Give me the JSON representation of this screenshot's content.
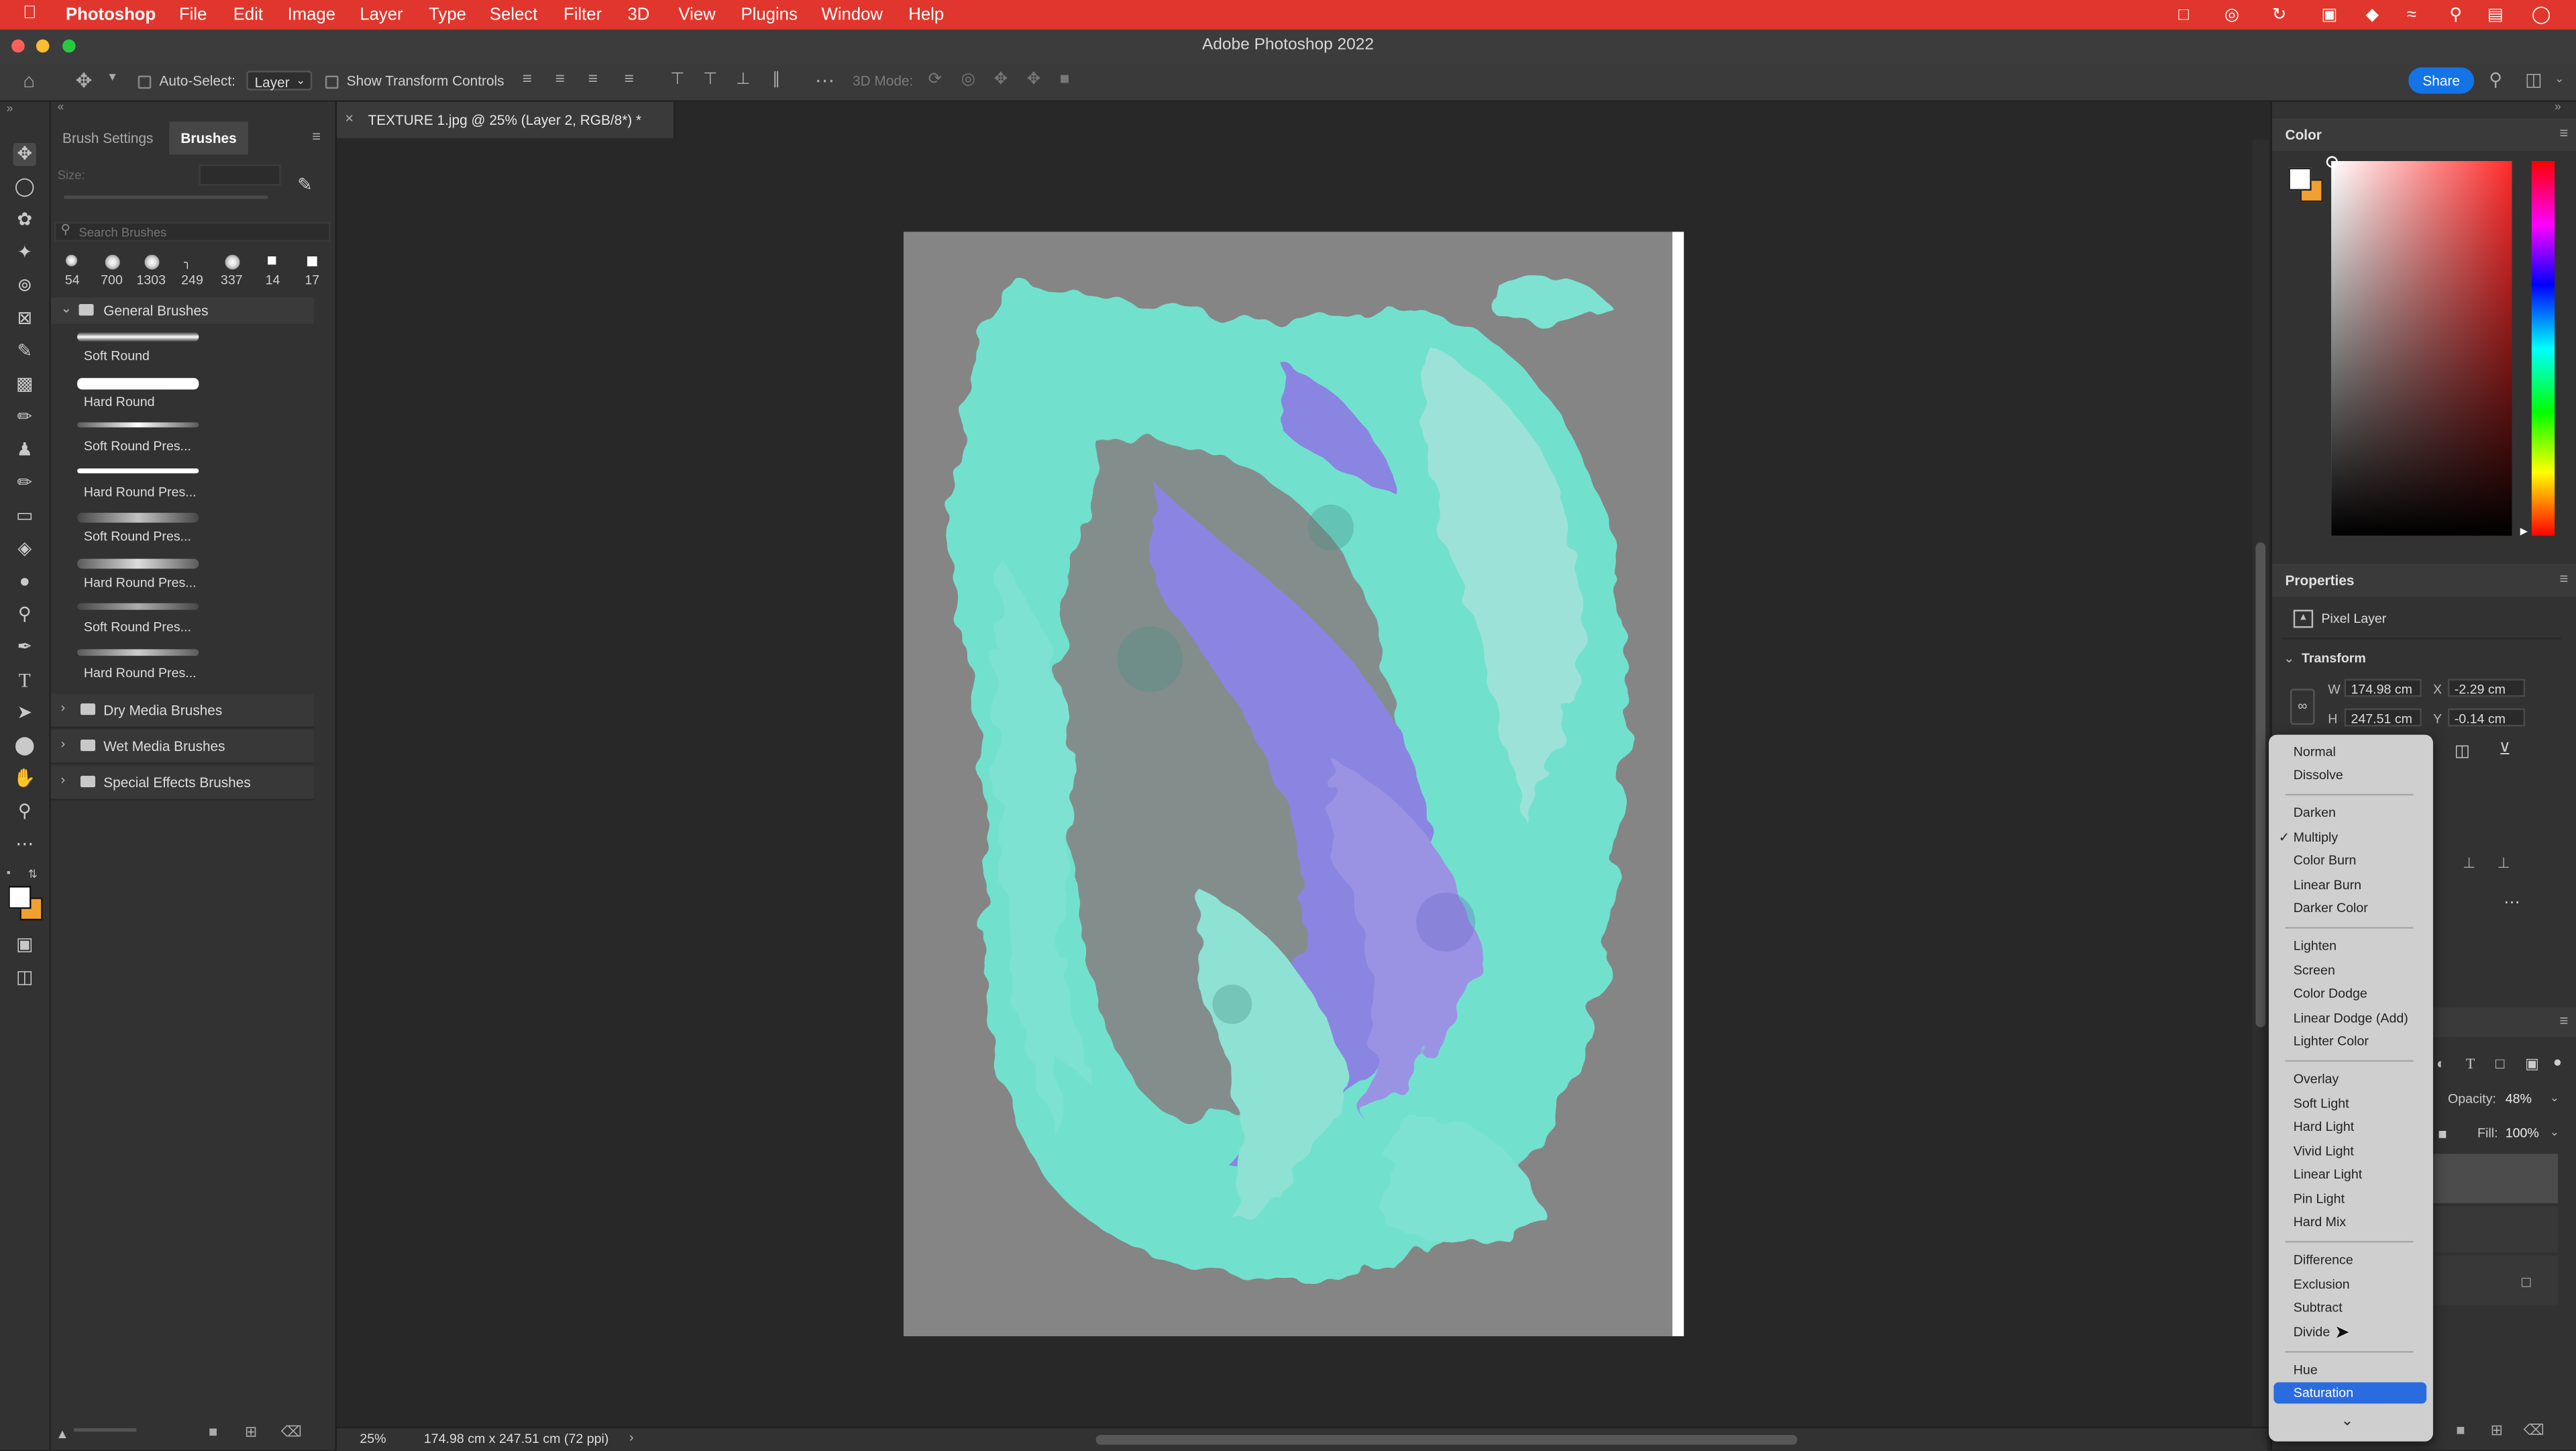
{
  "menubar": {
    "app": "Photoshop",
    "items": [
      "File",
      "Edit",
      "Image",
      "Layer",
      "Type",
      "Select",
      "Filter",
      "3D",
      "View",
      "Plugins",
      "Window",
      "Help"
    ]
  },
  "window": {
    "title": "Adobe Photoshop 2022"
  },
  "options": {
    "auto_select_label": "Auto-Select:",
    "auto_select_value": "Layer",
    "show_transform_label": "Show Transform Controls",
    "mode_3d_label": "3D Mode:",
    "share_label": "Share"
  },
  "left_panel": {
    "tabs": [
      "Brush Settings",
      "Brushes"
    ],
    "size_label": "Size:",
    "search_placeholder": "Search Brushes",
    "recent_sizes": [
      "54",
      "700",
      "1303",
      "249",
      "337",
      "14",
      "17"
    ],
    "group_label": "General Brushes",
    "brushes": [
      "Soft Round",
      "Hard Round",
      "Soft Round Pres...",
      "Hard Round Pres...",
      "Soft Round Pres...",
      "Hard Round Pres...",
      "Soft Round Pres...",
      "Hard Round Pres..."
    ],
    "folders": [
      "Dry Media Brushes",
      "Wet Media Brushes",
      "Special Effects Brushes"
    ]
  },
  "document": {
    "tab_title": "TEXTURE 1.jpg @ 25% (Layer 2, RGB/8*) *",
    "zoom": "25%",
    "dimensions": "174.98 cm x 247.51 cm (72 ppi)"
  },
  "color_panel": {
    "title": "Color"
  },
  "properties": {
    "title": "Properties",
    "layer_type": "Pixel Layer",
    "transform_label": "Transform",
    "w_label": "W",
    "w_value": "174.98 cm",
    "x_label": "X",
    "x_value": "-2.29 cm",
    "h_label": "H",
    "h_value": "247.51 cm",
    "y_label": "Y",
    "y_value": "-0.14 cm"
  },
  "layers": {
    "opacity_label": "Opacity:",
    "opacity_value": "48%",
    "fill_label": "Fill:",
    "fill_value": "100%"
  },
  "blend_menu": {
    "groups": [
      [
        "Normal",
        "Dissolve"
      ],
      [
        "Darken",
        "Multiply",
        "Color Burn",
        "Linear Burn",
        "Darker Color"
      ],
      [
        "Lighten",
        "Screen",
        "Color Dodge",
        "Linear Dodge (Add)",
        "Lighter Color"
      ],
      [
        "Overlay",
        "Soft Light",
        "Hard Light",
        "Vivid Light",
        "Linear Light",
        "Pin Light",
        "Hard Mix"
      ],
      [
        "Difference",
        "Exclusion",
        "Subtract",
        "Divide"
      ],
      [
        "Hue",
        "Saturation"
      ]
    ],
    "checked": "Multiply",
    "highlighted": "Saturation"
  },
  "colors": {
    "menubar": "#e1362d",
    "share_button": "#1473e6",
    "highlight": "#2a6ce0",
    "paint_cyan": "#6fe6d2",
    "paint_violet": "#8a86e6"
  }
}
